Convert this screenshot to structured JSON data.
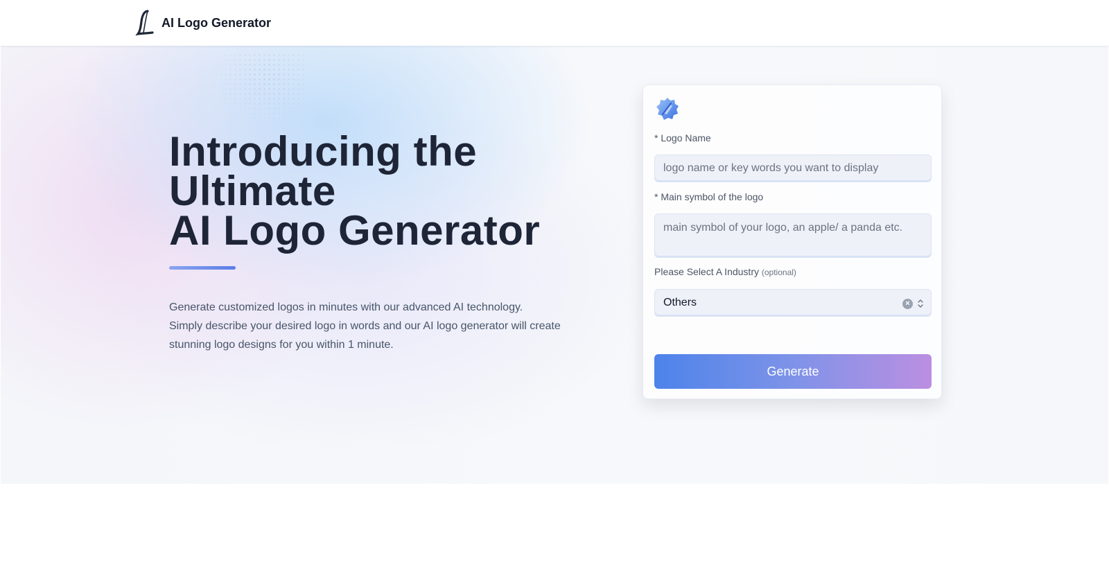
{
  "header": {
    "brand_name": "AI Logo Generator",
    "logo_icon": "script-letter-l-icon"
  },
  "hero": {
    "headline_lines": [
      "Introducing the",
      "Ultimate",
      "AI Logo Generator"
    ],
    "description_lines": [
      "Generate customized logos in minutes with our advanced AI technology.",
      "Simply describe your desired logo in words and our AI logo generator will create",
      "stunning logo designs for you within 1 minute."
    ]
  },
  "form": {
    "icon": "blue-badge-icon",
    "logo_name": {
      "label": "* Logo Name",
      "placeholder": "logo name or key words you want to display",
      "value": ""
    },
    "main_symbol": {
      "label": "* Main symbol of the logo",
      "placeholder": "main symbol of your logo, an apple/ a panda etc.",
      "value": ""
    },
    "industry": {
      "label": "Please Select A Industry",
      "optional_note": "(optional)",
      "selected": "Others"
    },
    "generate_label": "Generate"
  },
  "colors": {
    "accent_blue": "#4d83ea",
    "accent_purple": "#bb8fe2",
    "heading": "#1e2536"
  }
}
